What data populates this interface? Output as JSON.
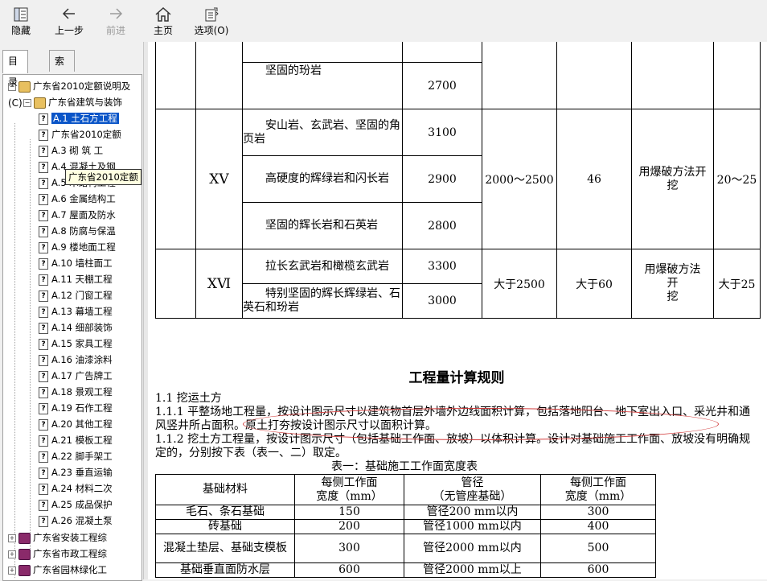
{
  "toolbar": {
    "hide": "隐藏",
    "back": "上一步",
    "forward": "前进",
    "home": "主页",
    "options": "选项(O)"
  },
  "tabs": {
    "contents": "目录(C)",
    "index": "索引(N)"
  },
  "tree": {
    "root": "广东省2010定额说明及",
    "sub": "广东省建筑与装饰",
    "items": [
      "A.1  土石方工程",
      "广东省2010定额",
      "A.3  砌  筑  工",
      "A.4  混凝土及钢",
      "A.5  木结构工程",
      "A.6  金属结构工",
      "A.7 屋面及防水",
      "A.8  防腐与保温",
      "A.9  楼地面工程",
      "A.10  墙柱面工",
      "A.11  天棚工程",
      "A.12  门窗工程",
      "A.13  幕墙工程",
      "A.14  细部装饰",
      "A.15  家具工程",
      "A.16  油漆涂料",
      "A.17  广告牌工",
      "A.18 景观工程",
      "A.19 石作工程",
      "A.20  其他工程",
      "A.21  模板工程",
      "A.22  脚手架工",
      "A.23  垂直运输",
      "A.24  材料二次",
      "A.25  成品保护",
      "A.26  混凝土泵"
    ],
    "tooltip": "广东省2010定额",
    "bottom": [
      "广东省安装工程综",
      "广东省市政工程综",
      "广东省园林绿化工"
    ]
  },
  "table1": {
    "r0": {
      "desc": "",
      "val": ""
    },
    "r1": {
      "desc": "坚固的玢岩",
      "val": "2700"
    },
    "xv": {
      "grade": "ⅩⅤ",
      "rows": [
        {
          "desc": "安山岩、玄武岩、坚固的角页岩",
          "val": "3100"
        },
        {
          "desc": "高硬度的辉绿岩和闪长岩",
          "val": "2900"
        },
        {
          "desc": "坚固的辉长岩和石英岩",
          "val": "2800"
        }
      ],
      "range": "2000～2500",
      "coef": "46",
      "method": "用爆破方法开挖",
      "last": "20～25"
    },
    "xvi": {
      "grade": "ⅩⅥ",
      "rows": [
        {
          "desc": "拉长玄武岩和橄榄玄武岩",
          "val": "3300"
        },
        {
          "desc": "特别坚固的辉长辉绿岩、石英石和玢岩",
          "val": "3000"
        }
      ],
      "range": "大于2500",
      "coef": "大于60",
      "method1": "用爆破方法",
      "method2": "开",
      "method3": "挖",
      "last": "大于25"
    }
  },
  "rules": {
    "title": "工程量计算规则",
    "p1": "1.1  挖运土方",
    "p2": "1.1.1  平整场地工程量，按设计图示尺寸以建筑物首层外墙外边线面积计算，包括落地阳台、地下室出入口、采光井和通风竖井所占面积。原土打夯按设计图示尺寸以面积计算。",
    "p3": "1.1.2  挖土方工程量，按设计图示尺寸（包括基础工作面、放坡）以体积计算。设计对基础施工工作面、放坡没有明确规定的，分别按下表（表一、二）取定。",
    "caption": "表一：基础施工工作面宽度表"
  },
  "table2": {
    "headers": [
      "基础材料",
      "每侧工作面\n宽度（mm）",
      "管径\n（无管座基础）",
      "每侧工作面\n宽度（mm）"
    ],
    "rows": [
      [
        "毛石、条石基础",
        "150",
        "管径200 mm以内",
        "300"
      ],
      [
        "砖基础",
        "200",
        "管径1000 mm以内",
        "400"
      ],
      [
        "混凝土垫层、基础支模板",
        "300",
        "管径2000 mm以内",
        "500"
      ],
      [
        "基础垂直面防水层",
        "600",
        "管径2000 mm以上",
        "600"
      ]
    ]
  },
  "colors": {
    "selection": "#0a55c8",
    "annotation": "#d23c3c",
    "tooltip_bg": "#ffffe1"
  }
}
